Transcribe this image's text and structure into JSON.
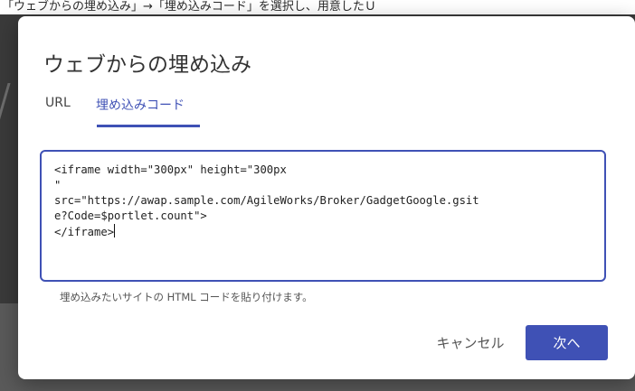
{
  "background": {
    "top_text": "「ウェブからの埋め込み」→「埋め込みコード」を選択し、用意したＵ"
  },
  "dialog": {
    "title": "ウェブからの埋め込み",
    "tabs": [
      {
        "label": "URL",
        "selected": false
      },
      {
        "label": "埋め込みコード",
        "selected": true
      }
    ],
    "code_input": {
      "value": "<iframe width=\"300px\" height=\"300px\n\"\nsrc=\"https://awap.sample.com/AgileWorks/Broker/GadgetGoogle.gsit\ne?Code=$portlet.count\">\n</iframe>"
    },
    "helper_text": "埋め込みたいサイトの HTML コードを貼り付けます。",
    "buttons": {
      "cancel": "キャンセル",
      "next": "次へ"
    }
  },
  "colors": {
    "accent": "#3f51b5",
    "overlay": "#3a3a3a"
  }
}
